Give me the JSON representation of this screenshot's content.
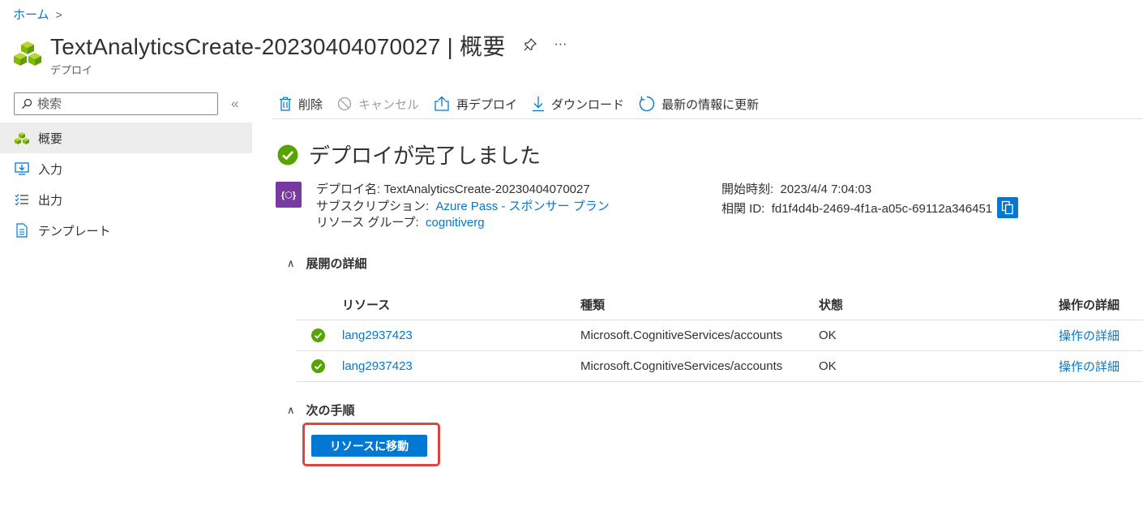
{
  "breadcrumb": {
    "home": "ホーム",
    "sep": ">"
  },
  "header": {
    "title": "TextAnalyticsCreate-20230404070027 | 概要",
    "subtitle": "デプロイ",
    "more": "···"
  },
  "sidebar": {
    "search_placeholder": "検索",
    "collapse": "«",
    "items": [
      {
        "label": "概要",
        "icon": "overview-icon",
        "active": true
      },
      {
        "label": "入力",
        "icon": "input-icon",
        "active": false
      },
      {
        "label": "出力",
        "icon": "output-icon",
        "active": false
      },
      {
        "label": "テンプレート",
        "icon": "template-icon",
        "active": false
      }
    ]
  },
  "toolbar": {
    "delete": "削除",
    "cancel": "キャンセル",
    "redeploy": "再デプロイ",
    "download": "ダウンロード",
    "refresh": "最新の情報に更新"
  },
  "status": {
    "title": "デプロイが完了しました"
  },
  "deployment": {
    "name_label": "デプロイ名:",
    "name_value": "TextAnalyticsCreate-20230404070027",
    "subscription_label": "サブスクリプション:",
    "subscription_value": "Azure Pass - スポンサー プラン",
    "rg_label": "リソース グループ:",
    "rg_value": "cognitiverg",
    "start_label": "開始時刻:",
    "start_value": "2023/4/4 7:04:03",
    "corr_label": "相関 ID:",
    "corr_value": "fd1f4d4b-2469-4f1a-a05c-69112a346451",
    "icon_text": "{⬡}"
  },
  "details": {
    "heading": "展開の詳細",
    "columns": {
      "resource": "リソース",
      "type": "種類",
      "state": "状態",
      "ops": "操作の詳細"
    },
    "rows": [
      {
        "resource": "lang2937423",
        "type": "Microsoft.CognitiveServices/accounts",
        "state": "OK",
        "ops": "操作の詳細"
      },
      {
        "resource": "lang2937423",
        "type": "Microsoft.CognitiveServices/accounts",
        "state": "OK",
        "ops": "操作の詳細"
      }
    ]
  },
  "next_steps": {
    "heading": "次の手順",
    "button": "リソースに移動"
  },
  "colors": {
    "accent": "#0078d4",
    "success": "#57a300",
    "highlight": "#e0443f"
  }
}
